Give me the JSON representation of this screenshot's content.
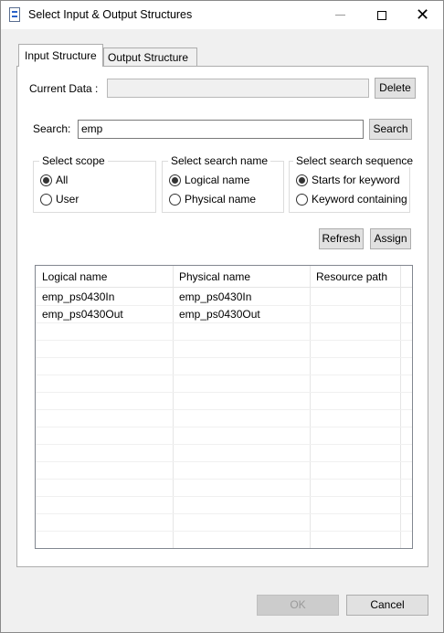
{
  "window": {
    "title": "Select Input & Output Structures",
    "minimize_icon": "minimize-icon",
    "maximize_icon": "maximize-icon",
    "close_icon": "close-icon",
    "close_glyph": "✕"
  },
  "tabs": [
    {
      "label": "Input Structure",
      "active": true
    },
    {
      "label": "Output Structure",
      "active": false
    }
  ],
  "current_data": {
    "label": "Current Data :",
    "value": "",
    "delete_label": "Delete"
  },
  "search": {
    "label": "Search:",
    "value": "emp",
    "button_label": "Search"
  },
  "scope": {
    "title": "Select scope",
    "options": [
      {
        "label": "All",
        "checked": true
      },
      {
        "label": "User",
        "checked": false
      }
    ]
  },
  "search_name": {
    "title": "Select search name",
    "options": [
      {
        "label": "Logical name",
        "checked": true
      },
      {
        "label": "Physical name",
        "checked": false
      }
    ]
  },
  "search_sequence": {
    "title": "Select search sequence",
    "options": [
      {
        "label": "Starts for keyword",
        "checked": true
      },
      {
        "label": "Keyword containing",
        "checked": false
      }
    ]
  },
  "actions": {
    "refresh_label": "Refresh",
    "assign_label": "Assign"
  },
  "table": {
    "columns": [
      "Logical name",
      "Physical name",
      "Resource path"
    ],
    "rows": [
      [
        "emp_ps0430In",
        "emp_ps0430In",
        ""
      ],
      [
        "emp_ps0430Out",
        "emp_ps0430Out",
        ""
      ]
    ]
  },
  "footer": {
    "ok_label": "OK",
    "cancel_label": "Cancel"
  }
}
